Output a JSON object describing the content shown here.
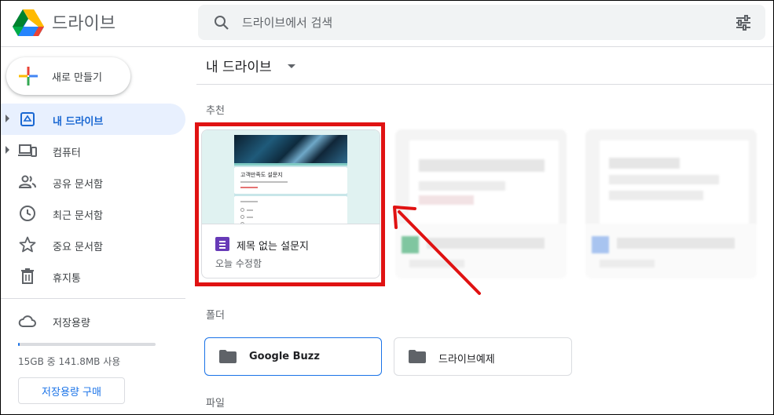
{
  "app": {
    "name": "드라이브"
  },
  "search": {
    "placeholder": "드라이브에서 검색"
  },
  "sidebar": {
    "new_label": "새로 만들기",
    "items": [
      {
        "label": "내 드라이브",
        "icon": "my-drive-icon",
        "active": true
      },
      {
        "label": "컴퓨터",
        "icon": "computer-icon"
      },
      {
        "label": "공유 문서함",
        "icon": "shared-icon"
      },
      {
        "label": "최근 문서함",
        "icon": "recent-icon"
      },
      {
        "label": "중요 문서함",
        "icon": "star-icon"
      },
      {
        "label": "휴지통",
        "icon": "trash-icon"
      }
    ],
    "storage": {
      "label": "저장용량",
      "usage_text": "15GB 중 141.8MB 사용",
      "used_fraction": 0.009,
      "buy_label": "저장용량 구매"
    }
  },
  "main": {
    "breadcrumb": "내 드라이브",
    "suggested_label": "추천",
    "folders_label": "폴더",
    "files_label": "파일",
    "suggested": [
      {
        "title": "제목 없는 설문지",
        "subtitle": "오늘 수정함",
        "preview_title": "고객만족도 설문지"
      }
    ],
    "folders": [
      {
        "name": "Google Buzz"
      },
      {
        "name": "드라이브예제"
      }
    ]
  },
  "colors": {
    "accent": "#1a73e8",
    "highlight": "#e01212",
    "forms": "#673ab7"
  }
}
